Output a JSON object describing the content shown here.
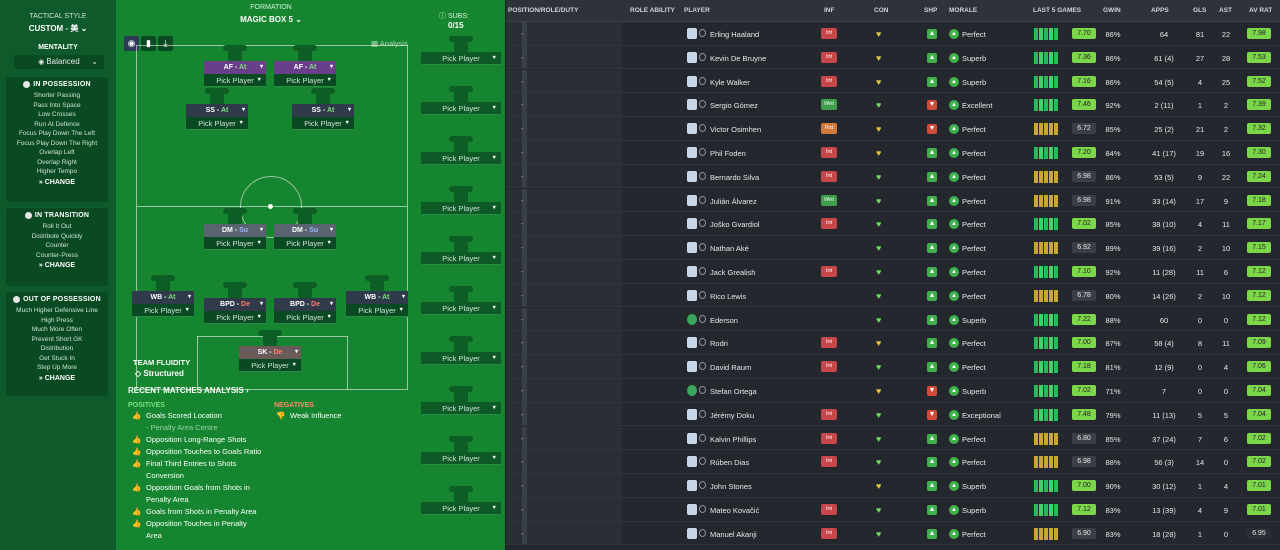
{
  "tactical": {
    "style_title": "TACTICAL STYLE",
    "style_value": "CUSTOM - 美",
    "mentality_title": "MENTALITY",
    "mentality_value": "Balanced",
    "in_possession": {
      "title": "IN POSSESSION",
      "items": [
        "Shorter Passing",
        "Pass Into Space",
        "Low Crosses",
        "Run At Defence",
        "Focus Play Down The Left",
        "Focus Play Down The Right",
        "Overlap Left",
        "Overlap Right",
        "Higher Tempo"
      ],
      "change": "CHANGE"
    },
    "in_transition": {
      "title": "IN TRANSITION",
      "items": [
        "Roll It Out",
        "Distribute Quickly",
        "Counter",
        "Counter-Press"
      ],
      "change": "CHANGE"
    },
    "out_of_possession": {
      "title": "OUT OF POSSESSION",
      "items": [
        "Much Higher Defensive Line",
        "High Press",
        "Much More Often",
        "Prevent Short GK",
        "Distribution",
        "Get Stuck In",
        "Step Up More"
      ],
      "change": "CHANGE"
    }
  },
  "formation": {
    "title": "FORMATION",
    "name": "MAGIC BOX 5",
    "subs_label": "SUBS:",
    "subs_value": "0/15",
    "analysis": "Analysis",
    "slots": [
      {
        "pos": "AF",
        "duty": "At",
        "player": "Pick Player"
      },
      {
        "pos": "AF",
        "duty": "At",
        "player": "Pick Player"
      },
      {
        "pos": "SS",
        "duty": "At",
        "player": "Pick Player"
      },
      {
        "pos": "SS",
        "duty": "At",
        "player": "Pick Player"
      },
      {
        "pos": "DM",
        "duty": "Su",
        "player": "Pick Player"
      },
      {
        "pos": "DM",
        "duty": "Su",
        "player": "Pick Player"
      },
      {
        "pos": "WB",
        "duty": "At",
        "player": "Pick Player"
      },
      {
        "pos": "BPD",
        "duty": "De",
        "player": "Pick Player"
      },
      {
        "pos": "BPD",
        "duty": "De",
        "player": "Pick Player"
      },
      {
        "pos": "WB",
        "duty": "At",
        "player": "Pick Player"
      },
      {
        "pos": "SK",
        "duty": "De",
        "player": "Pick Player"
      }
    ],
    "bench": [
      "Pick Player",
      "Pick Player",
      "Pick Player",
      "Pick Player",
      "Pick Player",
      "Pick Player",
      "Pick Player",
      "Pick Player",
      "Pick Player",
      "Pick Player"
    ],
    "fluidity_title": "TEAM FLUIDITY",
    "fluidity_value": "Structured"
  },
  "analysis": {
    "title": "RECENT MATCHES ANALYSIS",
    "positives_title": "POSITIVES",
    "negatives_title": "NEGATIVES",
    "positives": [
      "Goals Scored Location",
      "- Penalty Area Centre",
      "Opposition Long-Range Shots",
      "Opposition Touches to Goals Ratio",
      "Final Third Entries to Shots",
      "Conversion",
      "Opposition Goals from Shots in",
      "Penalty Area",
      "Goals from Shots in Penalty Area",
      "Opposition Touches in Penalty",
      "Area"
    ],
    "negatives": [
      "Weak Influence"
    ]
  },
  "table": {
    "headers": {
      "pos": "POSITION/ROLE/DUTY",
      "ability": "ROLE ABILITY",
      "player": "PLAYER",
      "inf": "INF",
      "con": "CON",
      "shp": "SHP",
      "morale": "MORALE",
      "last5": "LAST 5 GAMES",
      "gwin": "GWIN",
      "apps": "APPS",
      "gls": "GLS",
      "ast": "AST",
      "avrat": "AV RAT"
    },
    "rows": [
      {
        "pos": "-",
        "name": "Erling Haaland",
        "inf": "Int",
        "morale": "Perfect",
        "l5": "7.70",
        "gwin": "86%",
        "apps": "64",
        "gls": "81",
        "ast": "22",
        "av": "7.98"
      },
      {
        "pos": "-",
        "name": "Kevin De Bruyne",
        "inf": "Int",
        "morale": "Superb",
        "l5": "7.36",
        "gwin": "86%",
        "apps": "61 (4)",
        "gls": "27",
        "ast": "28",
        "av": "7.53"
      },
      {
        "pos": "-",
        "name": "Kyle Walker",
        "inf": "Int",
        "morale": "Superb",
        "l5": "7.16",
        "gwin": "86%",
        "apps": "54 (5)",
        "gls": "4",
        "ast": "25",
        "av": "7.52"
      },
      {
        "pos": "-",
        "name": "Sergio Gómez",
        "inf": "Wnt",
        "morale": "Excellent",
        "l5": "7.46",
        "gwin": "92%",
        "apps": "2 (11)",
        "gls": "1",
        "ast": "2",
        "av": "7.39"
      },
      {
        "pos": "-",
        "name": "Victor Osimhen",
        "inf": "Rst",
        "morale": "Perfect",
        "l5": "6.72",
        "gwin": "85%",
        "apps": "25 (2)",
        "gls": "21",
        "ast": "2",
        "av": "7.32"
      },
      {
        "pos": "-",
        "name": "Phil Foden",
        "inf": "Int",
        "morale": "Perfect",
        "l5": "7.20",
        "gwin": "84%",
        "apps": "41 (17)",
        "gls": "19",
        "ast": "16",
        "av": "7.30"
      },
      {
        "pos": "-",
        "name": "Bernardo Silva",
        "inf": "Int",
        "morale": "Perfect",
        "l5": "6.98",
        "gwin": "86%",
        "apps": "53 (5)",
        "gls": "9",
        "ast": "22",
        "av": "7.24"
      },
      {
        "pos": "-",
        "name": "Julián Álvarez",
        "inf": "Wnt",
        "morale": "Perfect",
        "l5": "6.98",
        "gwin": "91%",
        "apps": "33 (14)",
        "gls": "17",
        "ast": "9",
        "av": "7.18"
      },
      {
        "pos": "-",
        "name": "Joško Gvardiol",
        "inf": "Int",
        "morale": "Perfect",
        "l5": "7.02",
        "gwin": "85%",
        "apps": "38 (10)",
        "gls": "4",
        "ast": "11",
        "av": "7.17"
      },
      {
        "pos": "-",
        "name": "Nathan Aké",
        "inf": "",
        "morale": "Perfect",
        "l5": "6.92",
        "gwin": "89%",
        "apps": "39 (16)",
        "gls": "2",
        "ast": "10",
        "av": "7.15"
      },
      {
        "pos": "-",
        "name": "Jack Grealish",
        "inf": "Int",
        "morale": "Perfect",
        "l5": "7.10",
        "gwin": "92%",
        "apps": "11 (28)",
        "gls": "11",
        "ast": "6",
        "av": "7.12"
      },
      {
        "pos": "-",
        "name": "Rico Lewis",
        "inf": "",
        "morale": "Perfect",
        "l5": "6.78",
        "gwin": "80%",
        "apps": "14 (26)",
        "gls": "2",
        "ast": "10",
        "av": "7.12"
      },
      {
        "pos": "-",
        "name": "Ederson",
        "inf": "",
        "morale": "Superb",
        "l5": "7.22",
        "gwin": "88%",
        "apps": "60",
        "gls": "0",
        "ast": "0",
        "av": "7.12"
      },
      {
        "pos": "-",
        "name": "Rodri",
        "inf": "Int",
        "morale": "Perfect",
        "l5": "7.00",
        "gwin": "87%",
        "apps": "58 (4)",
        "gls": "8",
        "ast": "11",
        "av": "7.09"
      },
      {
        "pos": "-",
        "name": "David Raum",
        "inf": "Int",
        "morale": "Perfect",
        "l5": "7.18",
        "gwin": "81%",
        "apps": "12 (9)",
        "gls": "0",
        "ast": "4",
        "av": "7.06"
      },
      {
        "pos": "-",
        "name": "Stefan Ortega",
        "inf": "",
        "morale": "Superb",
        "l5": "7.02",
        "gwin": "71%",
        "apps": "7",
        "gls": "0",
        "ast": "0",
        "av": "7.04"
      },
      {
        "pos": "-",
        "name": "Jérémy Doku",
        "inf": "Int",
        "morale": "Exceptional",
        "l5": "7.48",
        "gwin": "79%",
        "apps": "11 (13)",
        "gls": "5",
        "ast": "5",
        "av": "7.04"
      },
      {
        "pos": "-",
        "name": "Kalvin Phillips",
        "inf": "Int",
        "morale": "Perfect",
        "l5": "6.80",
        "gwin": "85%",
        "apps": "37 (24)",
        "gls": "7",
        "ast": "6",
        "av": "7.02"
      },
      {
        "pos": "-",
        "name": "Rúben Dias",
        "inf": "Int",
        "morale": "Perfect",
        "l5": "6.98",
        "gwin": "88%",
        "apps": "56 (3)",
        "gls": "14",
        "ast": "0",
        "av": "7.02"
      },
      {
        "pos": "-",
        "name": "John Stones",
        "inf": "",
        "morale": "Superb",
        "l5": "7.00",
        "gwin": "90%",
        "apps": "30 (12)",
        "gls": "1",
        "ast": "4",
        "av": "7.01"
      },
      {
        "pos": "-",
        "name": "Mateo Kovačić",
        "inf": "Int",
        "morale": "Superb",
        "l5": "7.12",
        "gwin": "83%",
        "apps": "13 (39)",
        "gls": "4",
        "ast": "9",
        "av": "7.01"
      },
      {
        "pos": "-",
        "name": "Manuel Akanji",
        "inf": "Int",
        "morale": "Perfect",
        "l5": "6.90",
        "gwin": "83%",
        "apps": "18 (28)",
        "gls": "1",
        "ast": "0",
        "av": "6.95"
      }
    ]
  }
}
